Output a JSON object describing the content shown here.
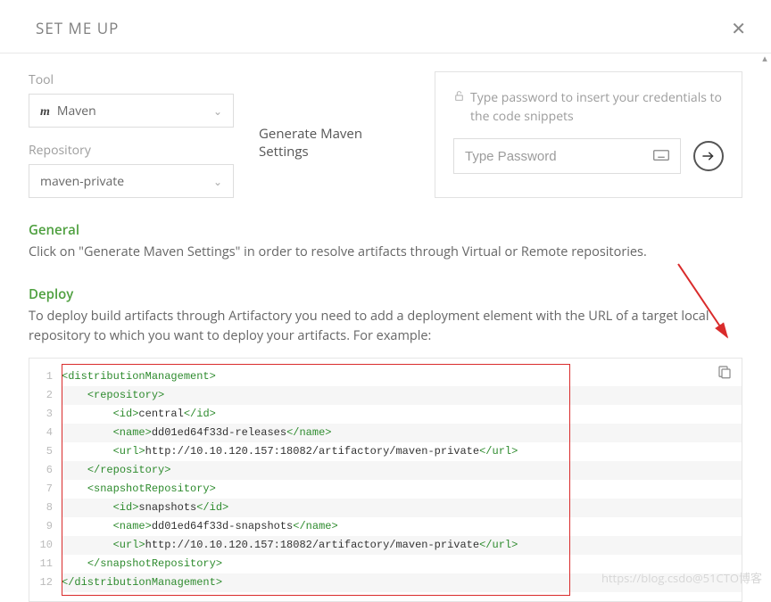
{
  "header": {
    "title": "SET ME UP"
  },
  "tool": {
    "label": "Tool",
    "value": "Maven"
  },
  "generate_label": "Generate Maven Settings",
  "repo": {
    "label": "Repository",
    "value": "maven-private"
  },
  "password": {
    "hint": "Type password to insert your credentials to the code snippets",
    "placeholder": "Type Password"
  },
  "general": {
    "head": "General",
    "text": "Click on \"Generate Maven Settings\" in order to resolve artifacts through Virtual or Remote repositories."
  },
  "deploy": {
    "head": "Deploy",
    "text": "To deploy build artifacts through Artifactory you need to add a deployment element with the URL of a target local repository to which you want to deploy your artifacts. For example:"
  },
  "code": {
    "lines": [
      {
        "indent": 0,
        "tokens": [
          {
            "t": "tag",
            "v": "<distributionManagement>"
          }
        ]
      },
      {
        "indent": 1,
        "tokens": [
          {
            "t": "tag",
            "v": "<repository>"
          }
        ]
      },
      {
        "indent": 2,
        "tokens": [
          {
            "t": "tag",
            "v": "<id>"
          },
          {
            "t": "txt",
            "v": "central"
          },
          {
            "t": "tag",
            "v": "</id>"
          }
        ]
      },
      {
        "indent": 2,
        "tokens": [
          {
            "t": "tag",
            "v": "<name>"
          },
          {
            "t": "txt",
            "v": "dd01ed64f33d-releases"
          },
          {
            "t": "tag",
            "v": "</name>"
          }
        ]
      },
      {
        "indent": 2,
        "tokens": [
          {
            "t": "tag",
            "v": "<url>"
          },
          {
            "t": "txt",
            "v": "http://10.10.120.157:18082/artifactory/maven-private"
          },
          {
            "t": "tag",
            "v": "</url>"
          }
        ]
      },
      {
        "indent": 1,
        "tokens": [
          {
            "t": "tag",
            "v": "</repository>"
          }
        ]
      },
      {
        "indent": 1,
        "tokens": [
          {
            "t": "tag",
            "v": "<snapshotRepository>"
          }
        ]
      },
      {
        "indent": 2,
        "tokens": [
          {
            "t": "tag",
            "v": "<id>"
          },
          {
            "t": "txt",
            "v": "snapshots"
          },
          {
            "t": "tag",
            "v": "</id>"
          }
        ]
      },
      {
        "indent": 2,
        "tokens": [
          {
            "t": "tag",
            "v": "<name>"
          },
          {
            "t": "txt",
            "v": "dd01ed64f33d-snapshots"
          },
          {
            "t": "tag",
            "v": "</name>"
          }
        ]
      },
      {
        "indent": 2,
        "tokens": [
          {
            "t": "tag",
            "v": "<url>"
          },
          {
            "t": "txt",
            "v": "http://10.10.120.157:18082/artifactory/maven-private"
          },
          {
            "t": "tag",
            "v": "</url>"
          }
        ]
      },
      {
        "indent": 1,
        "tokens": [
          {
            "t": "tag",
            "v": "</snapshotRepository>"
          }
        ]
      },
      {
        "indent": 0,
        "tokens": [
          {
            "t": "tag",
            "v": "</distributionManagement>"
          }
        ]
      }
    ]
  },
  "watermark": "https://blog.csdo@51CTO博客"
}
